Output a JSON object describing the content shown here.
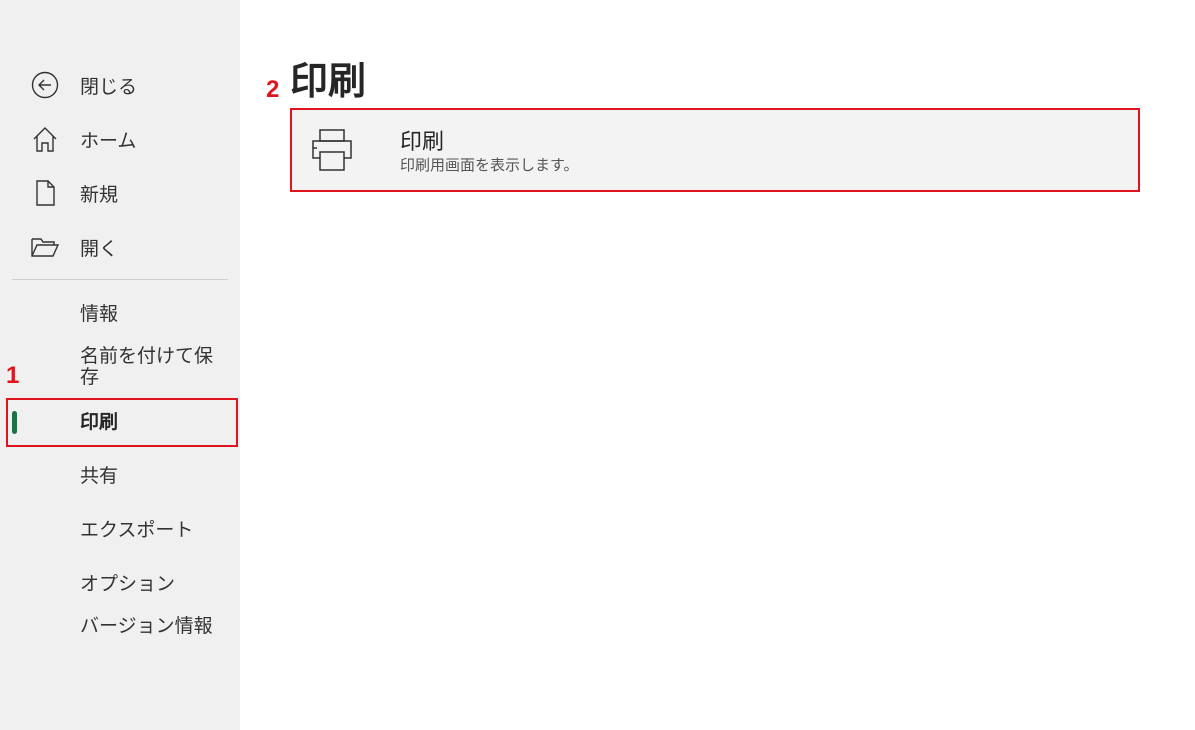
{
  "sidebar": {
    "top_items": [
      {
        "label": "閉じる",
        "icon": "back-arrow-icon"
      },
      {
        "label": "ホーム",
        "icon": "home-icon"
      },
      {
        "label": "新規",
        "icon": "new-document-icon"
      },
      {
        "label": "開く",
        "icon": "open-folder-icon"
      }
    ],
    "bottom_items": [
      {
        "label": "情報"
      },
      {
        "label": "名前を付けて保存"
      },
      {
        "label": "印刷",
        "selected": true
      },
      {
        "label": "共有"
      },
      {
        "label": "エクスポート"
      },
      {
        "label": "オプション"
      },
      {
        "label": "バージョン情報"
      }
    ]
  },
  "annotations": {
    "marker_1": "1",
    "marker_2": "2"
  },
  "main": {
    "title": "印刷",
    "print_option": {
      "title": "印刷",
      "description": "印刷用画面を表示します。",
      "icon": "printer-icon"
    }
  },
  "colors": {
    "sidebar_bg": "#f0f0f0",
    "selected_accent": "#1e7145",
    "annotation_red": "#e0141e",
    "card_bg": "#f3f3f3"
  }
}
